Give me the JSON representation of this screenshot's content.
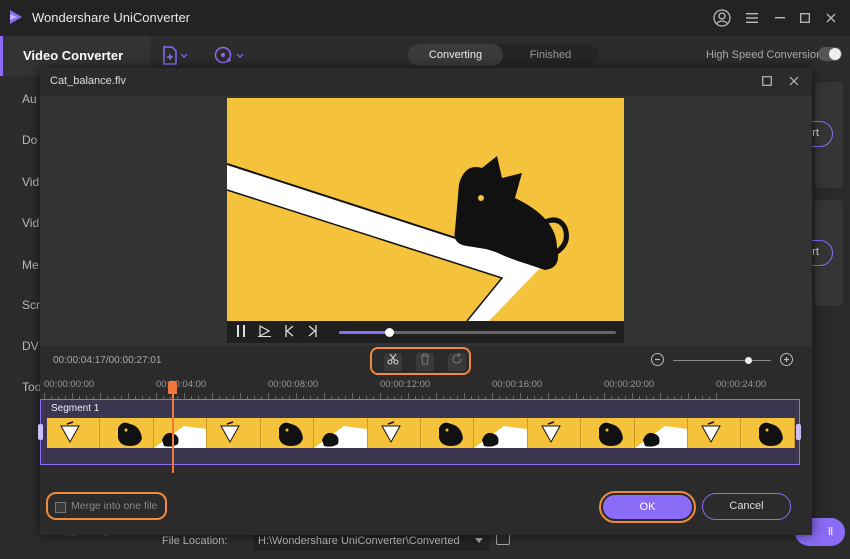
{
  "app": {
    "title": "Wondershare UniConverter",
    "accent_color": "#8b6cf6",
    "highlight_color": "#f08a3c"
  },
  "sidebar": {
    "items": [
      {
        "label": "Video Converter",
        "active": true
      },
      {
        "label": "Au"
      },
      {
        "label": "Do"
      },
      {
        "label": "Vid"
      },
      {
        "label": "Vid"
      },
      {
        "label": "Me"
      },
      {
        "label": "Scr"
      },
      {
        "label": "DV"
      },
      {
        "label": "Too"
      }
    ]
  },
  "toolbar": {
    "tabs": [
      {
        "label": "Converting",
        "active": true
      },
      {
        "label": "Finished",
        "active": false
      }
    ],
    "high_speed_label": "High Speed Conversion",
    "high_speed_on": false
  },
  "background": {
    "convert_btn_1": "rt",
    "convert_btn_2": "rt",
    "file_location_label": "File Location:",
    "file_location_value": "H:\\Wondershare UniConverter\\Converted",
    "start_all_label": "ll"
  },
  "modal": {
    "title": "Cat_balance.flv",
    "timecode": "00:00:04:17/00:00:27:01",
    "playback_progress": 0.18,
    "zoom_level": 0.7,
    "ruler_labels": [
      "00:00:00:00",
      "00:00:04:00",
      "00:00:08:00",
      "00:00:12:00",
      "00:00:16:00",
      "00:00:20:00",
      "00:00:24:00"
    ],
    "segment_label": "Segment 1",
    "merge_label": "Merge into one file",
    "merge_checked": false,
    "ok_label": "OK",
    "cancel_label": "Cancel"
  }
}
